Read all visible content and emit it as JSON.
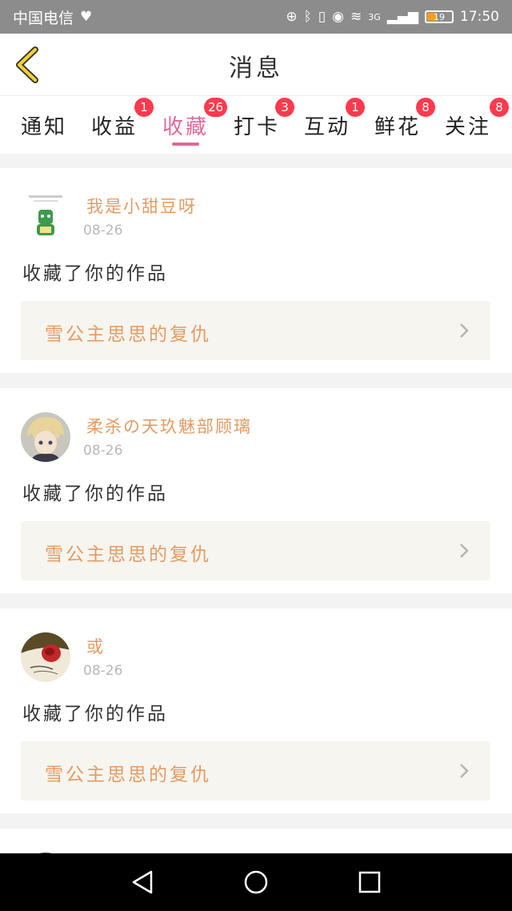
{
  "status_bar": {
    "carrier": "中国电信",
    "network": "3G",
    "battery": "19",
    "time": "17:50"
  },
  "header": {
    "title": "消息"
  },
  "tabs": [
    {
      "label": "通知",
      "badge": ""
    },
    {
      "label": "收益",
      "badge": "1"
    },
    {
      "label": "收藏",
      "badge": "26",
      "active": true
    },
    {
      "label": "打卡",
      "badge": "3"
    },
    {
      "label": "互动",
      "badge": "1"
    },
    {
      "label": "鲜花",
      "badge": "8"
    },
    {
      "label": "关注",
      "badge": "8"
    }
  ],
  "messages": [
    {
      "username": "我是小甜豆呀",
      "date": "08-26",
      "action": "收藏了你的作品",
      "work_title": "雪公主思思的复仇"
    },
    {
      "username": "柔杀の天玖魅部顾璃",
      "date": "08-26",
      "action": "收藏了你的作品",
      "work_title": "雪公主思思的复仇"
    },
    {
      "username": "或",
      "date": "08-26",
      "action": "收藏了你的作品",
      "work_title": "雪公主思思的复仇"
    }
  ],
  "colors": {
    "accent_pink": "#e0699a",
    "badge_red": "#ff3a4e",
    "name_orange": "#e49b63",
    "back_yellow": "#f2d23a"
  }
}
